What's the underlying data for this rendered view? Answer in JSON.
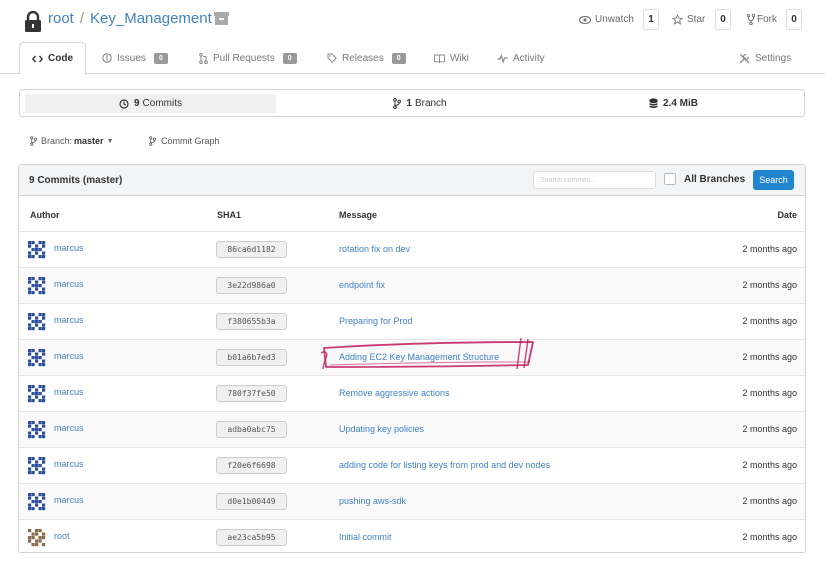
{
  "header": {
    "owner": "root",
    "separator": "/",
    "repo": "Key_Management",
    "unwatch_label": "Unwatch",
    "watch_count": "1",
    "star_label": "Star",
    "star_count": "0",
    "fork_label": "Fork",
    "fork_count": "0"
  },
  "tabs": [
    {
      "label": "Code",
      "icon": "code-icon"
    },
    {
      "label": "Issues",
      "badge": "0",
      "icon": "issue-icon"
    },
    {
      "label": "Pull Requests",
      "badge": "0",
      "icon": "pull-request-icon"
    },
    {
      "label": "Releases",
      "badge": "0",
      "icon": "tag-icon"
    },
    {
      "label": "Wiki",
      "icon": "book-icon"
    },
    {
      "label": "Activity",
      "icon": "pulse-icon"
    },
    {
      "label": "Settings",
      "icon": "tools-icon"
    }
  ],
  "stats": {
    "commits_count": "9",
    "commits_label": "Commits",
    "branch_count": "1",
    "branch_label": "Branch",
    "size": "2.4 MiB"
  },
  "branch": {
    "label": "Branch:",
    "value": "master",
    "graph_label": "Commit Graph"
  },
  "commits": {
    "title": "9 Commits (master)",
    "search_placeholder": "Search commits...",
    "all_branches_label": "All Branches",
    "search_button": "Search",
    "columns": {
      "author": "Author",
      "sha": "SHA1",
      "message": "Message",
      "date": "Date"
    },
    "rows": [
      {
        "author": "marcus",
        "sha": "86ca6d1182",
        "message": "rotation fix on dev",
        "date": "2 months ago"
      },
      {
        "author": "marcus",
        "sha": "3e22d986a0",
        "message": "endpoint fix",
        "date": "2 months ago"
      },
      {
        "author": "marcus",
        "sha": "f380655b3a",
        "message": "Preparing for Prod",
        "date": "2 months ago"
      },
      {
        "author": "marcus",
        "sha": "b01a6b7ed3",
        "message": "Adding EC2 Key Management Structure",
        "date": "2 months ago"
      },
      {
        "author": "marcus",
        "sha": "780f37fe50",
        "message": "Remove aggressive actions",
        "date": "2 months ago"
      },
      {
        "author": "marcus",
        "sha": "adba0abc75",
        "message": "Updating key policies",
        "date": "2 months ago"
      },
      {
        "author": "marcus",
        "sha": "f20e6f6698",
        "message": "adding code for listing keys from prod and dev nodes",
        "date": "2 months ago"
      },
      {
        "author": "marcus",
        "sha": "d0e1b00449",
        "message": "pushing aws-sdk",
        "date": "2 months ago"
      },
      {
        "author": "root",
        "sha": "ae23ca5b95",
        "message": "Initial commit",
        "date": "2 months ago"
      }
    ]
  },
  "colors": {
    "link": "#4183c4",
    "primary_button": "#2185d0",
    "annotation": "#c2185b",
    "avatar_marcus": "#2b4f9e",
    "avatar_root": "#8a6a4c"
  }
}
